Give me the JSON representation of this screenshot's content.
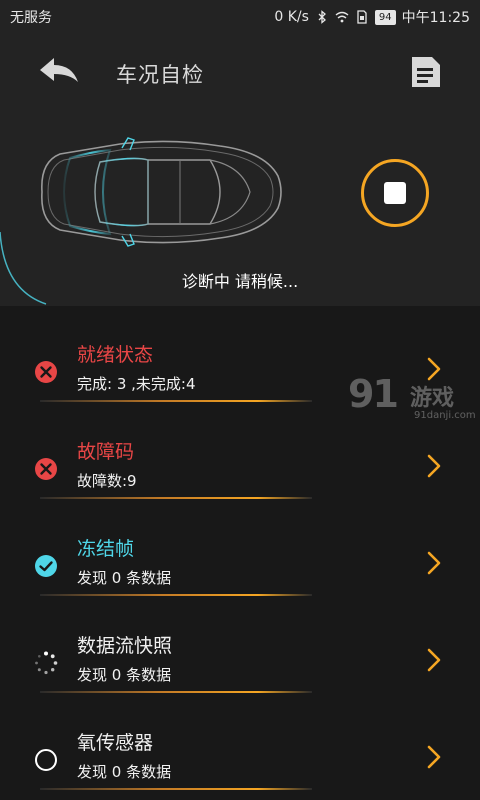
{
  "statusbar": {
    "carrier": "无服务",
    "speed": "0 K/s",
    "battery": "94",
    "time": "中午11:25"
  },
  "header": {
    "title": "车况自检",
    "status": "诊断中 请稍候..."
  },
  "colors": {
    "accent": "#f5a623",
    "error": "#e84646",
    "success": "#4fd6e8",
    "background": "#181818",
    "panel": "#232323"
  },
  "items": [
    {
      "name": "就绪状态",
      "detail": "完成: 3 ,未完成:4",
      "state": "error",
      "icon": "error-x-icon"
    },
    {
      "name": "故障码",
      "detail": "故障数:9",
      "state": "error",
      "icon": "error-x-icon"
    },
    {
      "name": "冻结帧",
      "detail": "发现 0 条数据",
      "state": "ok",
      "icon": "check-icon"
    },
    {
      "name": "数据流快照",
      "detail": "发现 0 条数据",
      "state": "loading",
      "icon": "loading-spinner-icon"
    },
    {
      "name": "氧传感器",
      "detail": "发现 0 条数据",
      "state": "pending",
      "icon": "pending-circle-icon"
    }
  ],
  "watermark": {
    "logo": "91",
    "text": "游戏",
    "url": "91danji.com"
  }
}
